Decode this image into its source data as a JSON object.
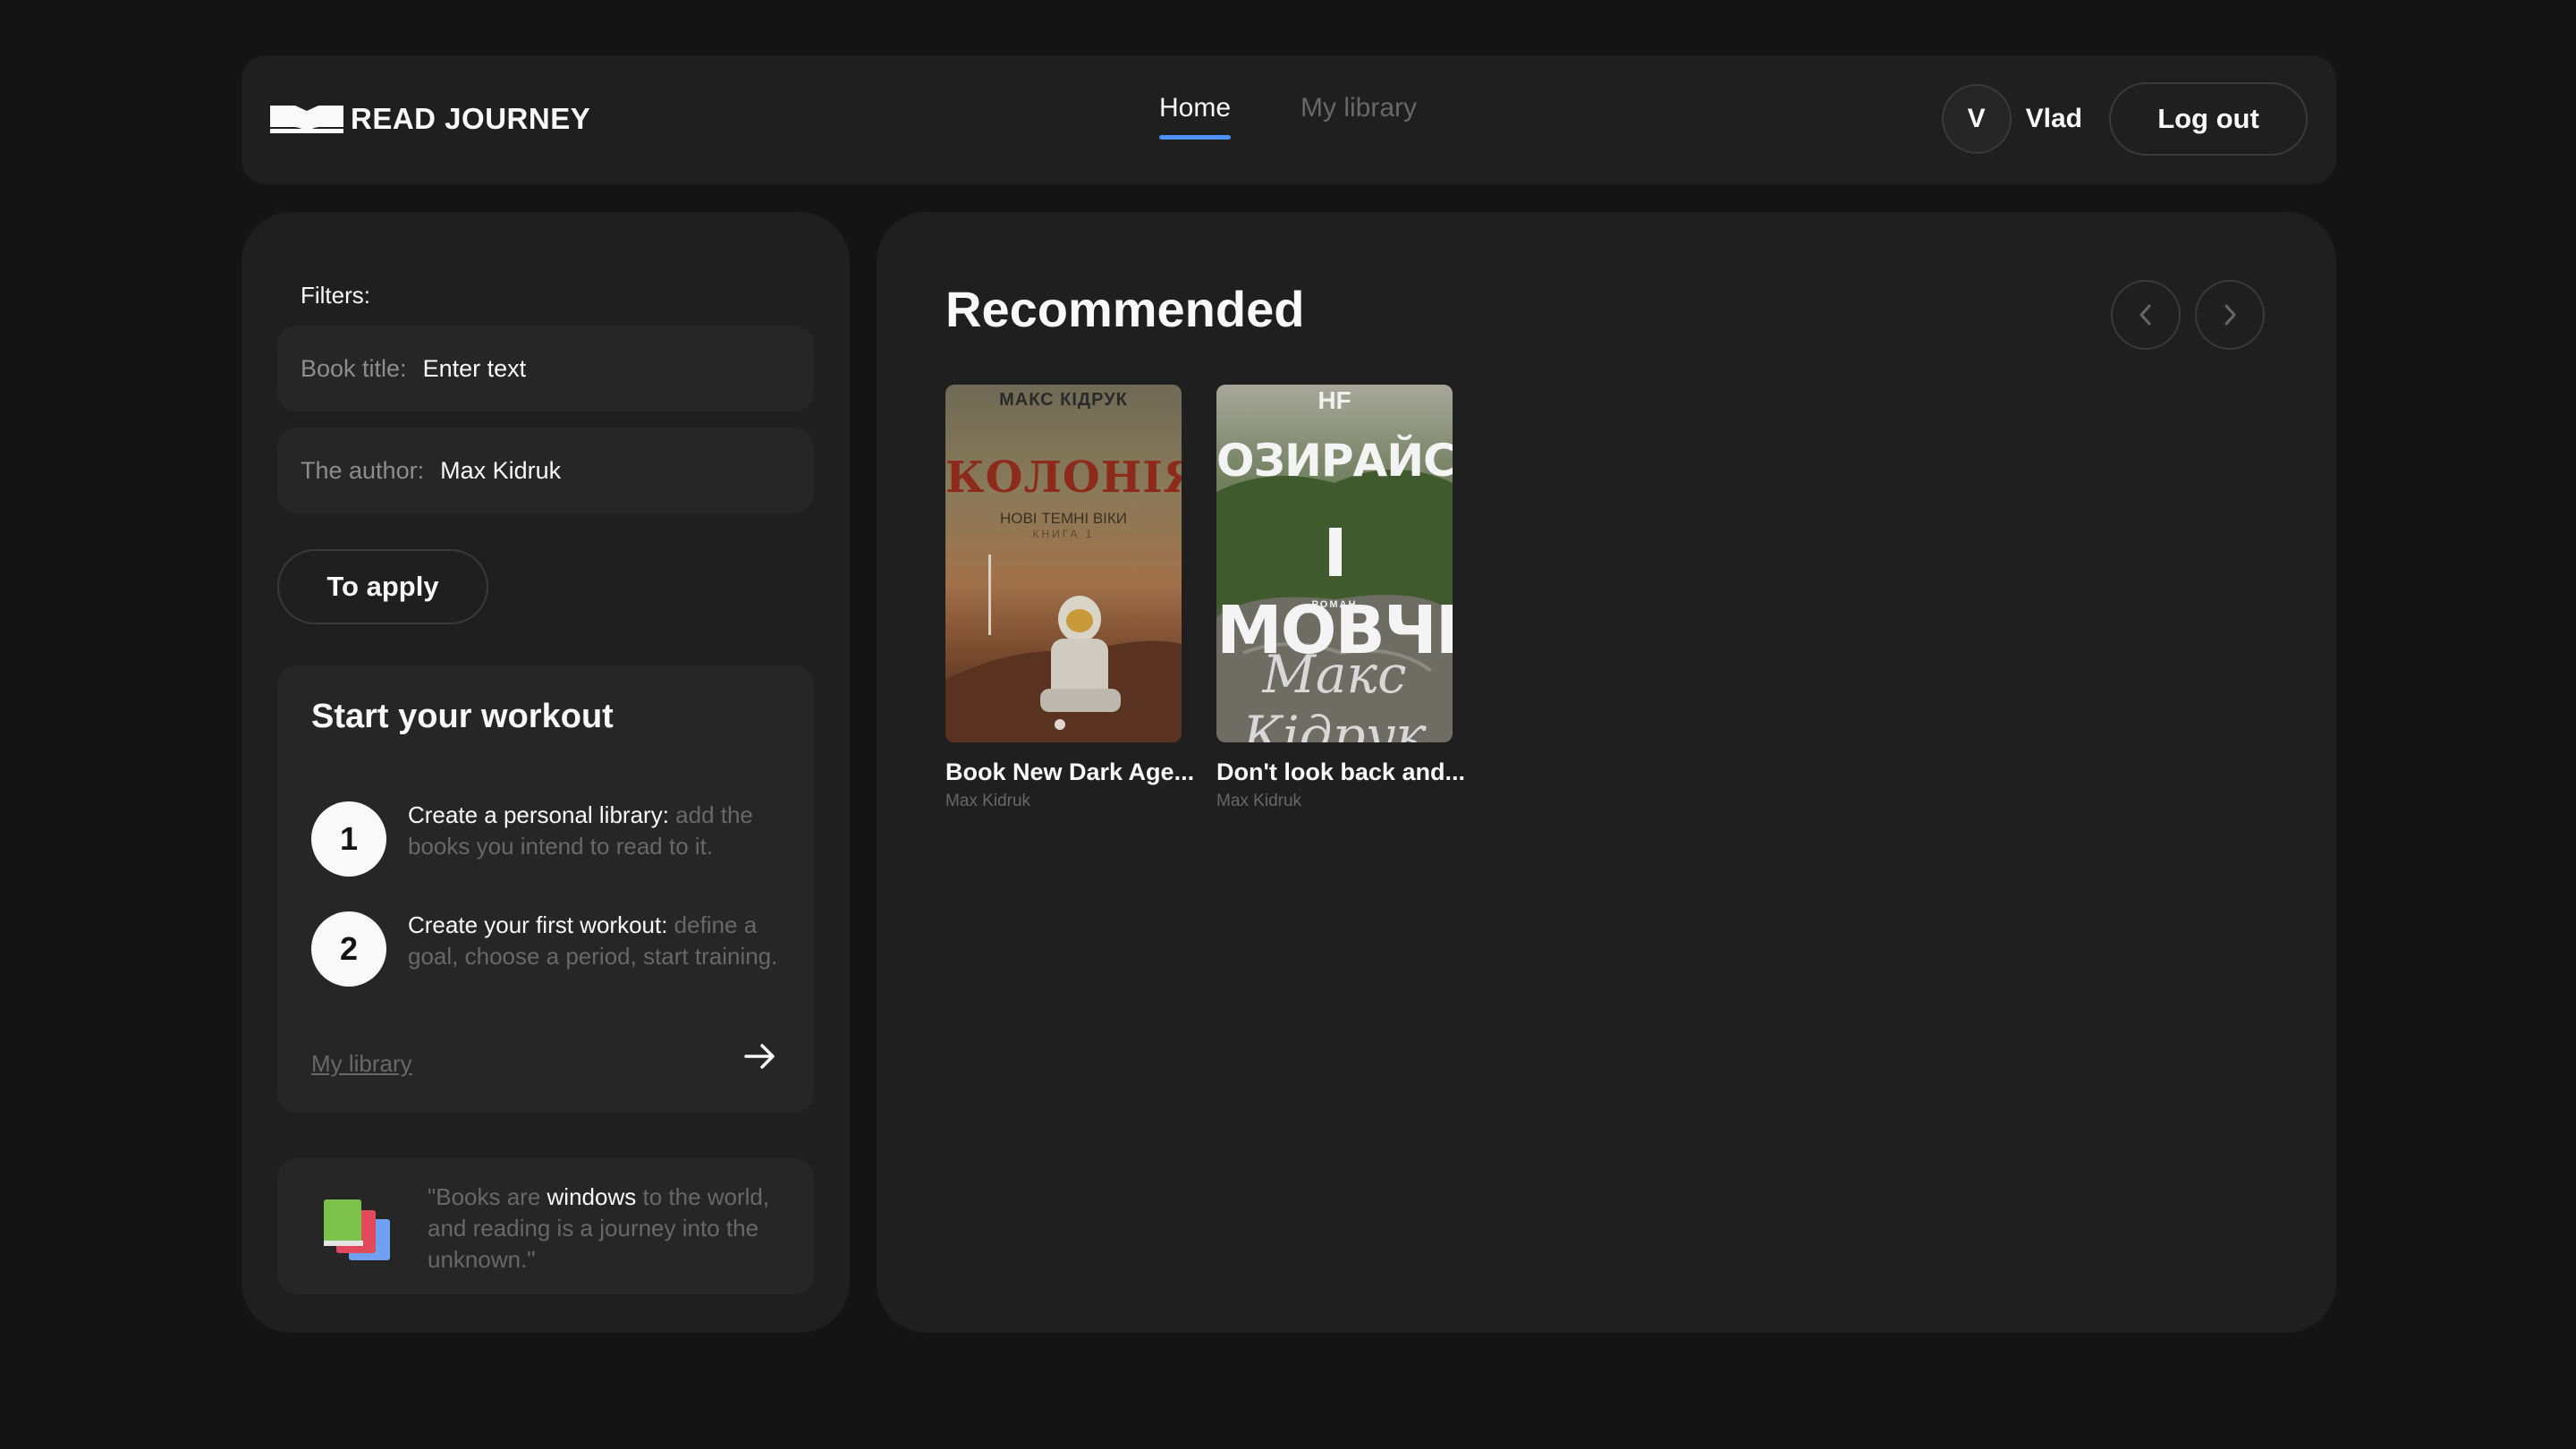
{
  "header": {
    "logo_text": "READ JOURNEY",
    "nav": [
      {
        "label": "Home",
        "active": true
      },
      {
        "label": "My library",
        "active": false
      }
    ],
    "user_initial": "V",
    "user_name": "Vlad",
    "logout_label": "Log out"
  },
  "sidebar": {
    "filters_label": "Filters:",
    "title_field": {
      "label": "Book title:",
      "value": "Enter text"
    },
    "author_field": {
      "label": "The author:",
      "value": "Max Kidruk"
    },
    "apply_label": "To apply",
    "workout": {
      "title": "Start your workout",
      "steps": [
        {
          "num": "1",
          "strong": "Create a personal library:",
          "muted": " add the books you intend to read to it."
        },
        {
          "num": "2",
          "strong": "Create your first workout:",
          "muted": " define a goal, choose a period, start training."
        }
      ],
      "link_label": "My library"
    },
    "quote": {
      "pre": "\"Books are ",
      "highlight": "windows",
      "post": " to the world, and reading is a journey into the unknown.\""
    }
  },
  "main": {
    "title": "Recommended",
    "books": [
      {
        "title": "Book New Dark Age...",
        "author": "Max Kidruk",
        "cover": {
          "top": "МАКС КІДРУК",
          "big": "КОЛОНІЯ",
          "sub": "НОВІ ТЕМНІ ВІКИ",
          "sub2": "КНИГА 1"
        }
      },
      {
        "title": "Don't look back and...",
        "author": "Max Kidruk",
        "cover": {
          "top": "НF",
          "line1": "ОЗИРАЙСЯ",
          "line2": "І МОВЧИ",
          "small": "РОМАН",
          "sig": "Макс Кідрук"
        }
      }
    ]
  },
  "colors": {
    "background": "#141414",
    "panel": "#1f1f1f",
    "field": "#262626",
    "accent": "#4f92f7",
    "muted_text": "#686868"
  }
}
